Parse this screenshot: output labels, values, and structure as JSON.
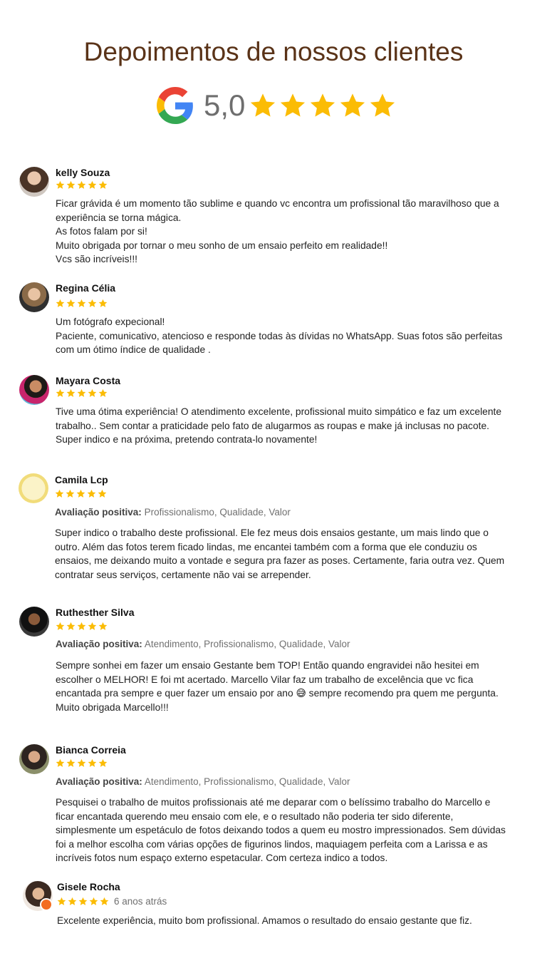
{
  "header": {
    "title": "Depoimentos de nossos clientes",
    "score": "5,0",
    "google_icon": "google-g-icon",
    "star_color": "#fbbc05"
  },
  "reviews": [
    {
      "name": "kelly Souza",
      "stars": 5,
      "lines": [
        "Ficar grávida é um momento tão sublime e quando vc encontra um profissional tão maravilhoso que a",
        "experiência se torna mágica.",
        "As fotos falam por si!",
        "Muito obrigada por tornar o meu sonho de um ensaio perfeito em realidade!!",
        "Vcs são incríveis!!!"
      ]
    },
    {
      "name": "Regina Célia",
      "stars": 5,
      "lines": [
        "Um fotógrafo expecional!",
        "Paciente, comunicativo, atencioso e responde todas às dívidas no WhatsApp. Suas fotos são perfeitas",
        "com um ótimo índice de qualidade ."
      ]
    },
    {
      "name": "Mayara Costa",
      "stars": 5,
      "lines": [
        "Tive uma ótima experiência! O atendimento excelente, profissional muito simpático e faz um excelente",
        "trabalho.. Sem contar a praticidade pelo fato de alugarmos as roupas e make já inclusas no pacote.",
        "Super indico e na próxima, pretendo contrata-lo novamente!"
      ]
    },
    {
      "name": "Camila Lcp",
      "stars": 5,
      "positive_label": "Avaliação positiva:",
      "positive_values": "Profissionalismo, Qualidade, Valor",
      "lines": [
        "Super indico o trabalho deste profissional. Ele fez meus dois ensaios gestante, um mais lindo que o",
        "outro. Além das fotos terem ficado lindas, me encantei também com a forma que ele conduziu os",
        "ensaios, me deixando muito a vontade e segura pra fazer as poses. Certamente, faria outra vez. Quem",
        "contratar seus serviços, certamente não vai se arrepender."
      ]
    },
    {
      "name": "Ruthesther Silva",
      "stars": 5,
      "positive_label": "Avaliação positiva:",
      "positive_values": "Atendimento, Profissionalismo, Qualidade, Valor",
      "lines": [
        "Sempre sonhei em fazer um ensaio Gestante bem TOP! Então quando engravidei não hesitei em",
        "escolher o MELHOR! E foi mt acertado. Marcello Vilar faz um trabalho de excelência que vc fica",
        "encantada pra sempre e quer fazer um ensaio por ano 😅 sempre recomendo pra quem me pergunta.",
        "Muito obrigada Marcello!!!"
      ]
    },
    {
      "name": "Bianca Correia",
      "stars": 5,
      "positive_label": "Avaliação positiva:",
      "positive_values": "Atendimento, Profissionalismo, Qualidade, Valor",
      "lines": [
        "Pesquisei o trabalho de muitos profissionais até me deparar com o belíssimo trabalho do Marcello e",
        "ficar encantada querendo meu ensaio com ele, e o resultado não poderia ter sido diferente,",
        "simplesmente um espetáculo de fotos deixando todos a quem eu mostro impressionados. Sem dúvidas",
        "foi a melhor escolha com várias opções de figurinos lindos, maquiagem perfeita com a Larissa e as",
        "incríveis fotos num espaço externo espetacular. Com certeza indico a todos."
      ]
    },
    {
      "name": "Gisele Rocha",
      "stars": 5,
      "ago": "6 anos atrás",
      "lines": [
        "Excelente experiência, muito bom profissional. Amamos o resultado do ensaio gestante que fiz."
      ]
    }
  ]
}
